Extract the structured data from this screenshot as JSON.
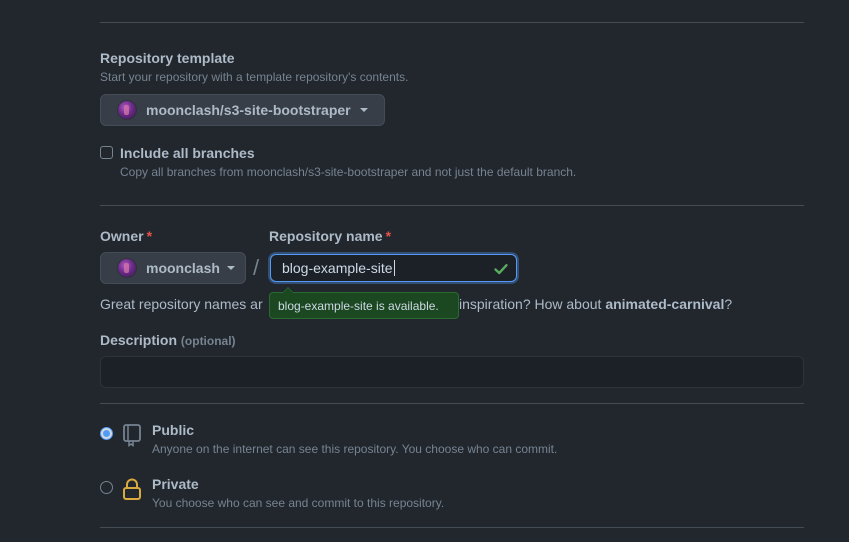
{
  "template": {
    "label": "Repository template",
    "description": "Start your repository with a template repository's contents.",
    "selected": "moonclash/s3-site-bootstraper"
  },
  "branches": {
    "label": "Include all branches",
    "description": "Copy all branches from moonclash/s3-site-bootstraper and not just the default branch.",
    "checked": false
  },
  "owner": {
    "label": "Owner",
    "required_mark": "*",
    "value": "moonclash"
  },
  "separator": "/",
  "repo_name": {
    "label": "Repository name",
    "required_mark": "*",
    "value": "blog-example-site",
    "availability": "blog-example-site is available."
  },
  "suggestion": {
    "prefix": "Great repository names ar",
    "middle": " inspiration? How about ",
    "name": "animated-carnival",
    "suffix": "?"
  },
  "description": {
    "label": "Description",
    "optional": "(optional)",
    "value": ""
  },
  "visibility": {
    "selected": "public",
    "options": [
      {
        "title": "Public",
        "description": "Anyone on the internet can see this repository. You choose who can commit.",
        "icon": "repo-icon"
      },
      {
        "title": "Private",
        "description": "You choose who can see and commit to this repository.",
        "icon": "lock-icon"
      }
    ]
  },
  "colors": {
    "background": "#22272e",
    "accent": "#539bf5",
    "success": "#57ab5a",
    "required": "#e5534b",
    "lock": "#daaa3f"
  }
}
